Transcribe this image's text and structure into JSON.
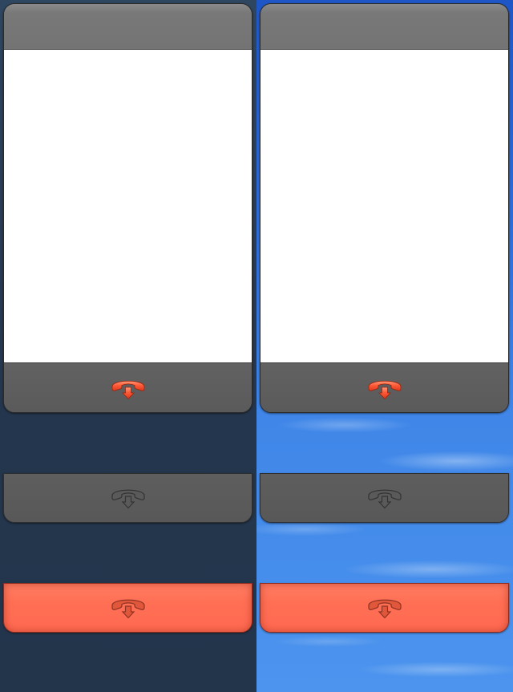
{
  "theme": {
    "left_background": "dark-navy",
    "right_background": "blue-sky",
    "hangup_color": "#ff5a36",
    "disabled_icon_color": "#3a3a3a",
    "pressed_icon_color": "#a8412c",
    "bar_color": "#5a5a5a",
    "pressed_bar_color": "#ff6f54"
  },
  "panels": [
    {
      "call_window": {
        "icon": "hangup-phone-icon",
        "state": "active"
      },
      "disabled_bar": {
        "icon": "hangup-phone-icon",
        "state": "disabled"
      },
      "pressed_bar": {
        "icon": "hangup-phone-icon",
        "state": "pressed"
      }
    },
    {
      "call_window": {
        "icon": "hangup-phone-icon",
        "state": "active"
      },
      "disabled_bar": {
        "icon": "hangup-phone-icon",
        "state": "disabled"
      },
      "pressed_bar": {
        "icon": "hangup-phone-icon",
        "state": "pressed"
      }
    }
  ]
}
